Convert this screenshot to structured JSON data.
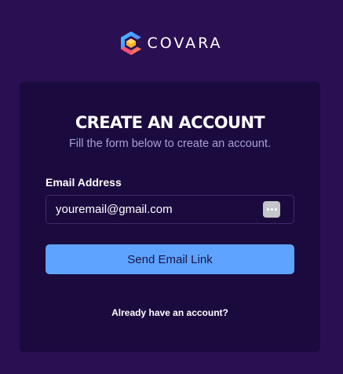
{
  "brand": {
    "logo_icon": "covara-hexagon-logo-icon",
    "name": "COVARA"
  },
  "form": {
    "title": "CREATE AN ACCOUNT",
    "subtitle": "Fill the form below to create an account.",
    "email_label": "Email Address",
    "email_value": "youremail@gmail.com",
    "password_manager_icon": "more-dots-icon",
    "submit_label": "Send Email Link",
    "login_link_label": "Already have an account?"
  },
  "colors": {
    "page_background": "#2a0f52",
    "card_background": "#1b0a3e",
    "button_primary": "#5ea3ff",
    "subtitle_text": "#a9a0d6"
  }
}
